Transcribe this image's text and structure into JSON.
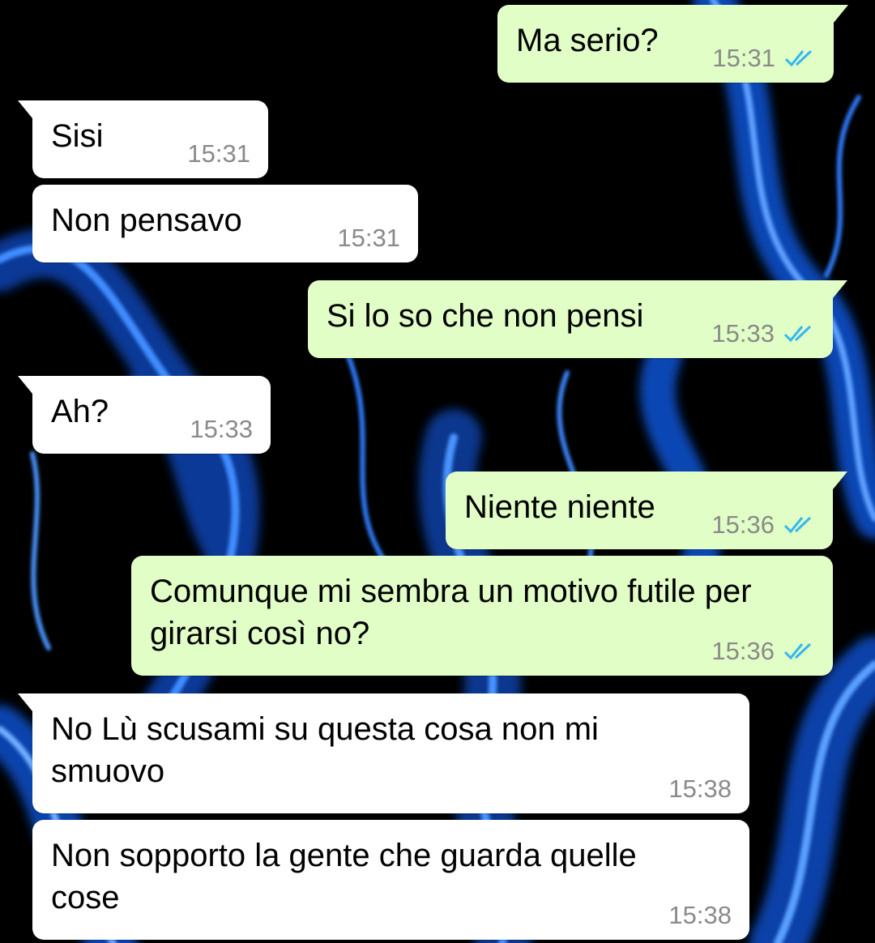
{
  "theme": {
    "incoming_bubble": "#ffffff",
    "outgoing_bubble": "#e1fec6",
    "timestamp_color": "#8a8a8a",
    "read_receipt_color": "#34b7f1",
    "wallpaper": "blue flames on black"
  },
  "messages": [
    {
      "direction": "out",
      "text": "Ma serio?",
      "time": "15:31",
      "status": "read",
      "status_icon": "double-check-icon"
    },
    {
      "direction": "in",
      "text": "Sisi",
      "time": "15:31"
    },
    {
      "direction": "in",
      "text": "Non pensavo",
      "time": "15:31"
    },
    {
      "direction": "out",
      "text": "Si lo so che non pensi",
      "time": "15:33",
      "status": "read",
      "status_icon": "double-check-icon"
    },
    {
      "direction": "in",
      "text": "Ah?",
      "time": "15:33"
    },
    {
      "direction": "out",
      "text": "Niente niente",
      "time": "15:36",
      "status": "read",
      "status_icon": "double-check-icon"
    },
    {
      "direction": "out",
      "text": "Comunque mi sembra un motivo futile per girarsi così no?",
      "time": "15:36",
      "status": "read",
      "status_icon": "double-check-icon"
    },
    {
      "direction": "in",
      "text": "No Lù scusami su questa cosa non mi smuovo",
      "time": "15:38"
    },
    {
      "direction": "in",
      "text": "Non sopporto la gente che guarda quelle cose",
      "time": "15:38"
    }
  ]
}
